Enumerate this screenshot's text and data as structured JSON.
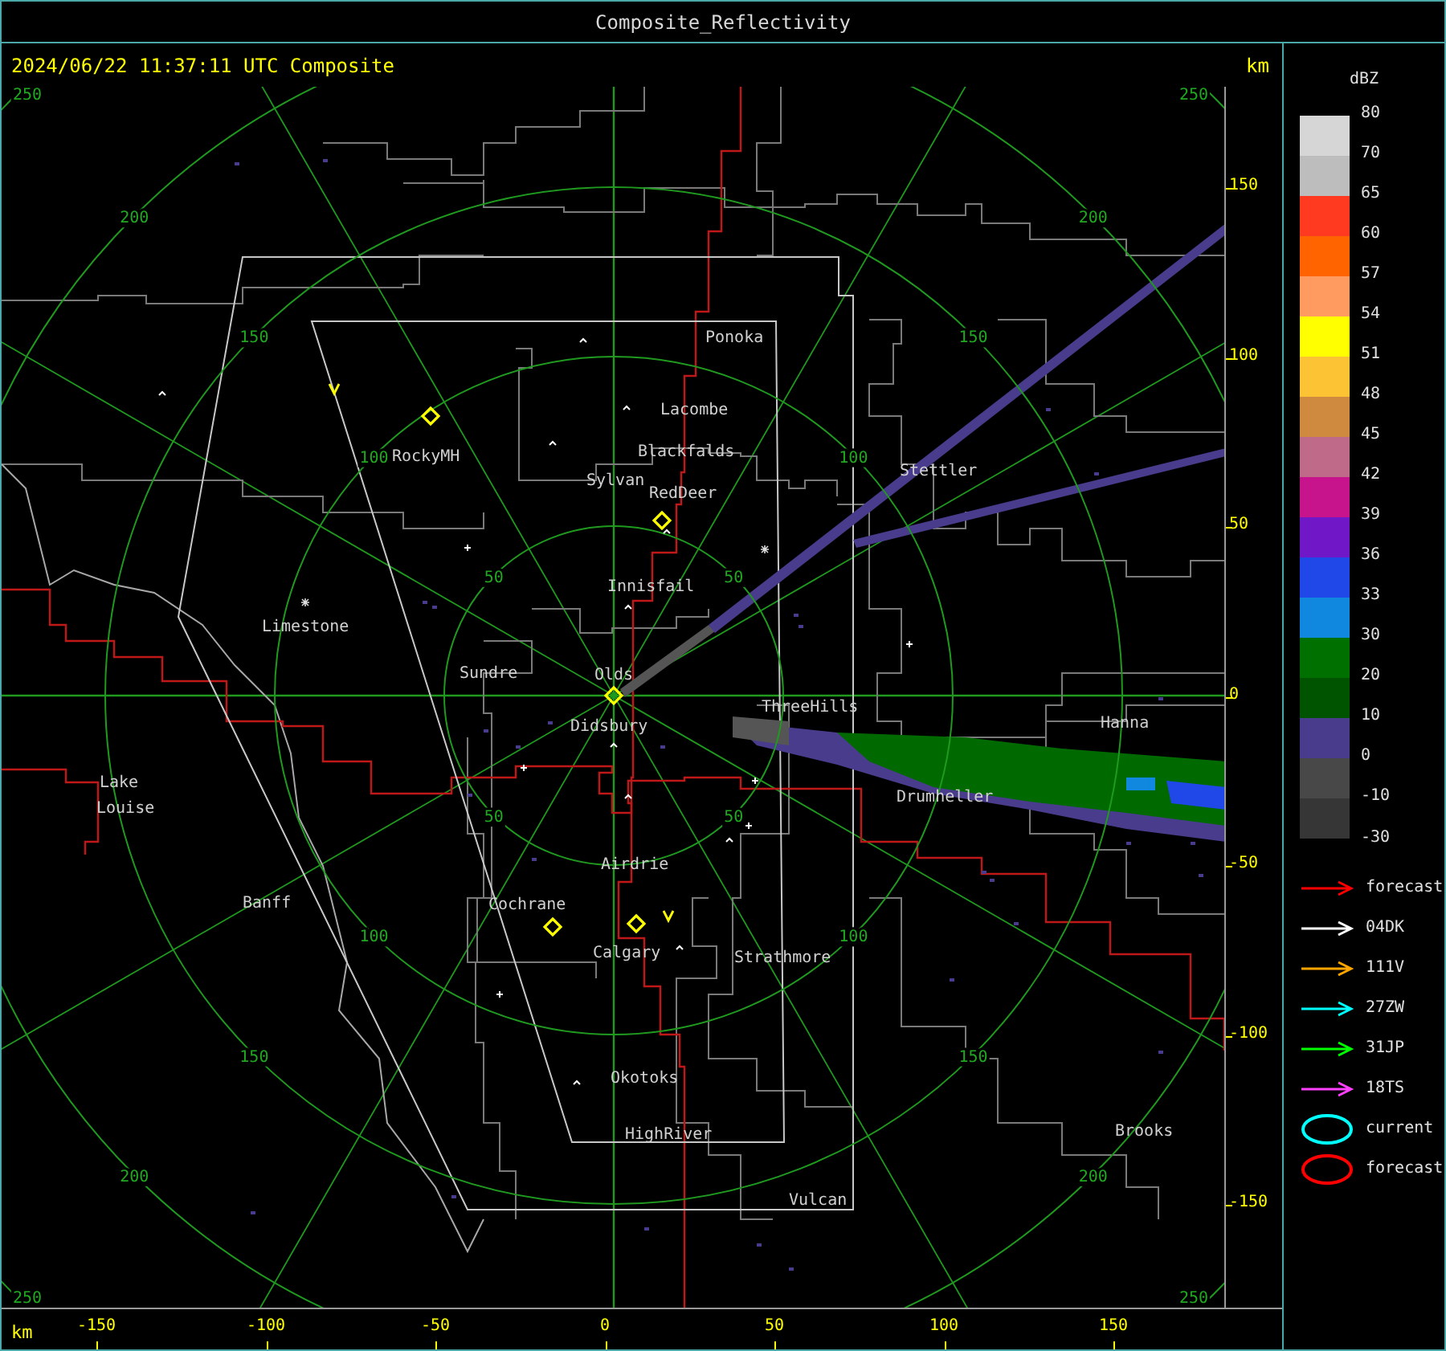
{
  "window": {
    "title": "Composite_Reflectivity"
  },
  "header": {
    "timestamp": "2024/06/22 11:37:11 UTC Composite",
    "unit": "km"
  },
  "map": {
    "range_rings": [
      {
        "labels": [
          "50",
          "50",
          "50",
          "50"
        ]
      },
      {
        "labels": [
          "100",
          "100",
          "100",
          "100"
        ]
      },
      {
        "labels": [
          "150",
          "150",
          "150",
          "150"
        ]
      },
      {
        "labels": [
          "200",
          "200",
          "200",
          "200"
        ]
      },
      {
        "labels": [
          "250",
          "250",
          "250",
          "250"
        ]
      }
    ],
    "places": [
      {
        "name": "Ponoka"
      },
      {
        "name": "Lacombe"
      },
      {
        "name": "Blackfalds"
      },
      {
        "name": "Sylvan"
      },
      {
        "name": "RedDeer"
      },
      {
        "name": "RockyMH"
      },
      {
        "name": "Innisfail"
      },
      {
        "name": "Limestone"
      },
      {
        "name": "Stettler"
      },
      {
        "name": "Sundre"
      },
      {
        "name": "Olds"
      },
      {
        "name": "ThreeHills"
      },
      {
        "name": "Didsbury"
      },
      {
        "name": "Hanna"
      },
      {
        "name": "Lake"
      },
      {
        "name": "Louise"
      },
      {
        "name": "Drumheller"
      },
      {
        "name": "Airdrie"
      },
      {
        "name": "Banff"
      },
      {
        "name": "Cochrane"
      },
      {
        "name": "Calgary"
      },
      {
        "name": "Strathmore"
      },
      {
        "name": "Okotoks"
      },
      {
        "name": "Brooks"
      },
      {
        "name": "HighRiver"
      },
      {
        "name": "Vulcan"
      }
    ]
  },
  "y_axis": {
    "ticks": [
      "150",
      "100",
      "50",
      "0",
      "-50",
      "-100",
      "-150"
    ]
  },
  "x_axis": {
    "unit": "km",
    "ticks": [
      "-150",
      "-100",
      "-50",
      "0",
      "50",
      "100",
      "150"
    ]
  },
  "legend": {
    "unit": "dBZ",
    "bands": [
      {
        "label": "80",
        "color": "#d6d6d6"
      },
      {
        "label": "70",
        "color": "#bdbdbd"
      },
      {
        "label": "65",
        "color": "#ff3a20"
      },
      {
        "label": "60",
        "color": "#ff6400"
      },
      {
        "label": "57",
        "color": "#ff9a60"
      },
      {
        "label": "54",
        "color": "#ffff00"
      },
      {
        "label": "51",
        "color": "#fcc435"
      },
      {
        "label": "48",
        "color": "#d08a40"
      },
      {
        "label": "45",
        "color": "#be6a88"
      },
      {
        "label": "42",
        "color": "#c8148c"
      },
      {
        "label": "39",
        "color": "#7018c8"
      },
      {
        "label": "36",
        "color": "#2048e8"
      },
      {
        "label": "33",
        "color": "#1088e0"
      },
      {
        "label": "30",
        "color": "#007000"
      },
      {
        "label": "20",
        "color": "#005400"
      },
      {
        "label": "10",
        "color": "#4a3c8c"
      },
      {
        "label": "0",
        "color": "#484848"
      },
      {
        "label": "-10",
        "color": "#363636"
      }
    ],
    "bottom_label": "-30",
    "tracks": [
      {
        "kind": "arrow",
        "color": "#ff0000",
        "label": "forecast"
      },
      {
        "kind": "arrow",
        "color": "#ffffff",
        "label": "04DK"
      },
      {
        "kind": "arrow",
        "color": "#ffa500",
        "label": "111V"
      },
      {
        "kind": "arrow",
        "color": "#00ffff",
        "label": "27ZW"
      },
      {
        "kind": "arrow",
        "color": "#00ff00",
        "label": "31JP"
      },
      {
        "kind": "arrow",
        "color": "#ff40ff",
        "label": "18TS"
      },
      {
        "kind": "ellipse",
        "color": "#00ffff",
        "label": "current"
      },
      {
        "kind": "ellipse",
        "color": "#ff0000",
        "label": "forecast"
      }
    ]
  }
}
